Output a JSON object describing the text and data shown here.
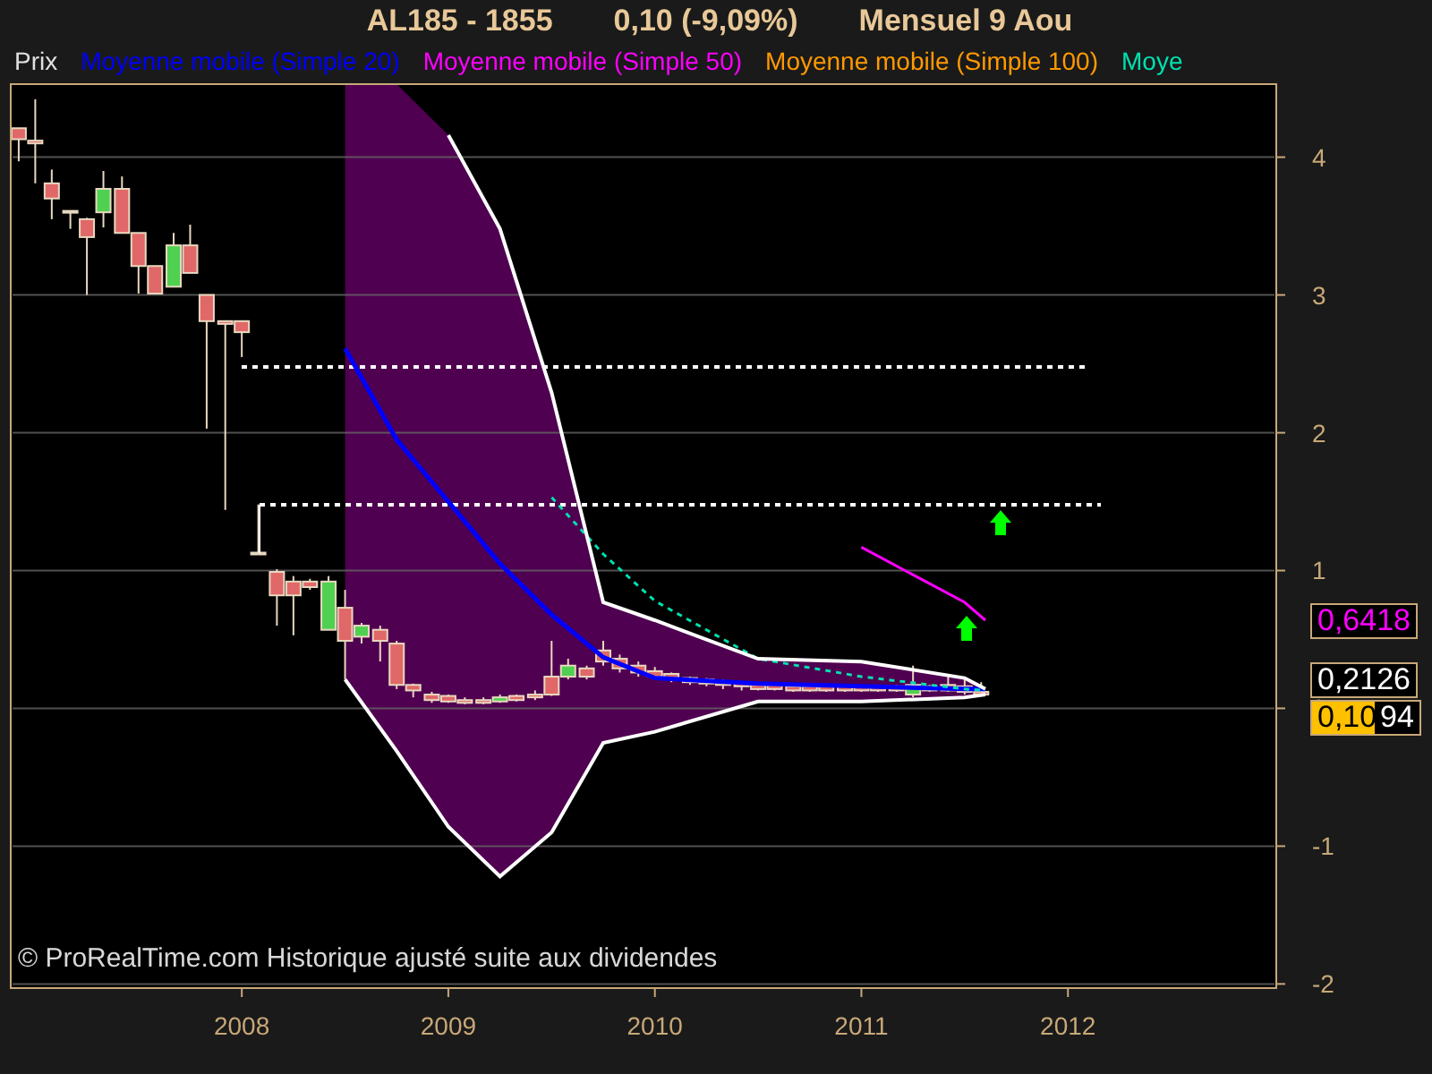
{
  "title": {
    "symbol": "AL185 - 1855",
    "quote": "0,10 (-9,09%)",
    "period": "Mensuel  9 Aou"
  },
  "legend": [
    {
      "label": "Prix",
      "color": "#e0e0e0"
    },
    {
      "label": "Moyenne mobile (Simple 20)",
      "color": "#0000ff"
    },
    {
      "label": "Moyenne mobile (Simple 50)",
      "color": "#ff00ff"
    },
    {
      "label": "Moyenne mobile (Simple 100)",
      "color": "#ff9900"
    },
    {
      "label": "Moye",
      "color": "#00e0b0"
    }
  ],
  "price_chart": {
    "chart_data": {
      "type": "candlestick",
      "xlim": [
        2006.89,
        2013.0
      ],
      "ylim": [
        -2.03,
        4.53
      ],
      "xticks": [
        2008,
        2009,
        2010,
        2011,
        2012
      ],
      "yticks": [
        -2,
        -1,
        0,
        1,
        2,
        3,
        4
      ],
      "grid": true,
      "x": [
        2006.92,
        2007.0,
        2007.08,
        2007.17,
        2007.25,
        2007.33,
        2007.42,
        2007.5,
        2007.58,
        2007.67,
        2007.75,
        2007.83,
        2007.92,
        2008.0,
        2008.08,
        2008.17,
        2008.25,
        2008.33,
        2008.42,
        2008.5,
        2008.58,
        2008.67,
        2008.75,
        2008.83,
        2008.92,
        2009.0,
        2009.08,
        2009.17,
        2009.25,
        2009.33,
        2009.42,
        2009.5,
        2009.58,
        2009.67,
        2009.75,
        2009.83,
        2009.92,
        2010.0,
        2010.08,
        2010.17,
        2010.25,
        2010.33,
        2010.42,
        2010.5,
        2010.58,
        2010.67,
        2010.75,
        2010.83,
        2010.92,
        2011.0,
        2011.08,
        2011.17,
        2011.25,
        2011.33,
        2011.42,
        2011.5,
        2011.58
      ],
      "ohlc": [
        [
          4.21,
          4.21,
          3.97,
          4.13
        ],
        [
          4.12,
          4.42,
          3.81,
          4.1
        ],
        [
          3.81,
          3.91,
          3.55,
          3.7
        ],
        [
          3.61,
          3.61,
          3.48,
          3.6
        ],
        [
          3.55,
          3.56,
          3.0,
          3.42
        ],
        [
          3.6,
          3.9,
          3.49,
          3.77
        ],
        [
          3.77,
          3.86,
          3.45,
          3.45
        ],
        [
          3.45,
          3.45,
          3.01,
          3.21
        ],
        [
          3.21,
          3.21,
          3.01,
          3.01
        ],
        [
          3.06,
          3.45,
          3.06,
          3.36
        ],
        [
          3.36,
          3.51,
          3.16,
          3.16
        ],
        [
          3.0,
          3.0,
          2.03,
          2.81
        ],
        [
          2.81,
          2.81,
          1.44,
          2.79
        ],
        [
          2.81,
          2.81,
          2.55,
          2.73
        ],
        [
          1.13,
          1.48,
          1.12,
          1.12
        ],
        [
          0.99,
          1.01,
          0.6,
          0.82
        ],
        [
          0.92,
          0.96,
          0.53,
          0.82
        ],
        [
          0.92,
          0.94,
          0.86,
          0.88
        ],
        [
          0.57,
          0.96,
          0.57,
          0.92
        ],
        [
          0.73,
          0.86,
          0.21,
          0.49
        ],
        [
          0.52,
          0.62,
          0.47,
          0.6
        ],
        [
          0.57,
          0.6,
          0.34,
          0.49
        ],
        [
          0.47,
          0.49,
          0.14,
          0.17
        ],
        [
          0.17,
          0.18,
          0.08,
          0.13
        ],
        [
          0.1,
          0.12,
          0.04,
          0.06
        ],
        [
          0.09,
          0.1,
          0.04,
          0.05
        ],
        [
          0.06,
          0.08,
          0.03,
          0.04
        ],
        [
          0.06,
          0.08,
          0.03,
          0.04
        ],
        [
          0.05,
          0.1,
          0.04,
          0.08
        ],
        [
          0.09,
          0.1,
          0.05,
          0.06
        ],
        [
          0.1,
          0.13,
          0.06,
          0.08
        ],
        [
          0.23,
          0.49,
          0.09,
          0.1
        ],
        [
          0.23,
          0.36,
          0.21,
          0.31
        ],
        [
          0.29,
          0.31,
          0.21,
          0.23
        ],
        [
          0.42,
          0.49,
          0.31,
          0.34
        ],
        [
          0.36,
          0.39,
          0.26,
          0.29
        ],
        [
          0.31,
          0.34,
          0.23,
          0.26
        ],
        [
          0.27,
          0.3,
          0.21,
          0.23
        ],
        [
          0.25,
          0.26,
          0.19,
          0.22
        ],
        [
          0.22,
          0.23,
          0.17,
          0.19
        ],
        [
          0.21,
          0.22,
          0.16,
          0.18
        ],
        [
          0.19,
          0.21,
          0.14,
          0.17
        ],
        [
          0.18,
          0.19,
          0.13,
          0.16
        ],
        [
          0.17,
          0.18,
          0.13,
          0.14
        ],
        [
          0.17,
          0.18,
          0.13,
          0.14
        ],
        [
          0.16,
          0.17,
          0.12,
          0.13
        ],
        [
          0.16,
          0.17,
          0.12,
          0.13
        ],
        [
          0.16,
          0.17,
          0.12,
          0.13
        ],
        [
          0.16,
          0.17,
          0.12,
          0.13
        ],
        [
          0.16,
          0.17,
          0.12,
          0.13
        ],
        [
          0.16,
          0.17,
          0.12,
          0.13
        ],
        [
          0.16,
          0.17,
          0.12,
          0.13
        ],
        [
          0.1,
          0.31,
          0.08,
          0.17
        ],
        [
          0.16,
          0.17,
          0.12,
          0.13
        ],
        [
          0.17,
          0.23,
          0.12,
          0.13
        ],
        [
          0.16,
          0.21,
          0.1,
          0.12
        ],
        [
          0.12,
          0.19,
          0.1,
          0.1
        ]
      ]
    }
  },
  "indicators": {
    "chart_data": {
      "type": "line",
      "x": [
        2008.5,
        2008.75,
        2009.0,
        2009.25,
        2009.5,
        2009.75,
        2010.0,
        2010.5,
        2011.0,
        2011.5,
        2011.6
      ],
      "xlim": [
        2006.89,
        2013.0
      ],
      "ylim": [
        -2.03,
        4.53
      ],
      "series": [
        {
          "color": "#0000ff",
          "line_style": "solid",
          "values": [
            2.61,
            1.95,
            1.5,
            1.05,
            0.68,
            0.37,
            0.22,
            0.18,
            0.16,
            0.14,
            0.14
          ]
        },
        {
          "color": "#ff00ff",
          "line_style": "solid",
          "values": [
            null,
            null,
            null,
            null,
            null,
            null,
            null,
            null,
            1.17,
            0.77,
            0.64
          ]
        },
        {
          "color": "#00e0b0",
          "line_style": "dashed",
          "values": [
            null,
            null,
            null,
            null,
            1.53,
            1.12,
            0.78,
            0.36,
            0.23,
            0.14,
            0.13
          ]
        },
        {
          "color": "#ffffff",
          "line_style": "solid",
          "values": [
            null,
            null,
            4.16,
            3.48,
            2.29,
            0.77,
            0.64,
            0.36,
            0.34,
            0.22,
            0.14
          ]
        },
        {
          "color": "#ffffff",
          "line_style": "solid",
          "values": [
            0.21,
            -0.31,
            -0.86,
            -1.22,
            -0.9,
            -0.25,
            -0.17,
            0.05,
            0.05,
            0.08,
            0.1
          ]
        }
      ]
    }
  },
  "price_labels": [
    {
      "text": "0,6418",
      "kind": "magenta"
    },
    {
      "text": "0,2126",
      "kind": "white"
    },
    {
      "text": "0,10",
      "kind": "current"
    },
    {
      "text": "94",
      "kind": "partial"
    }
  ],
  "footer": "© ProRealTime.com Historique ajusté suite aux dividendes"
}
